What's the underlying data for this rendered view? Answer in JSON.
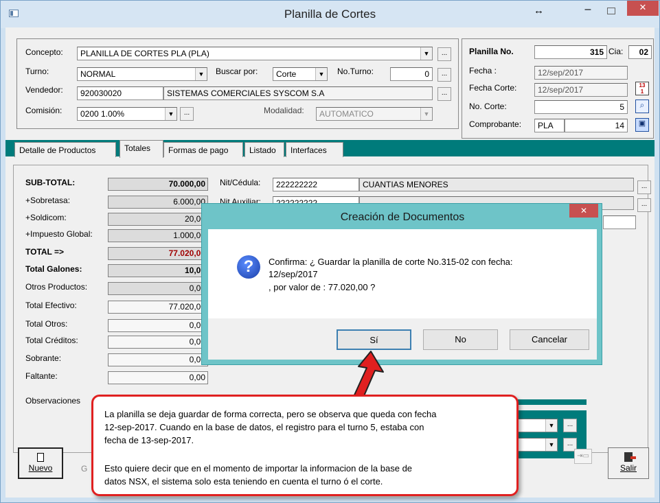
{
  "window": {
    "title": "Planilla de Cortes"
  },
  "header": {
    "concepto_label": "Concepto:",
    "concepto_value": "PLANILLA DE CORTES PLA  (PLA)",
    "turno_label": "Turno:",
    "turno_value": "NORMAL",
    "buscar_label": "Buscar por:",
    "buscar_value": "Corte",
    "noturno_label": "No.Turno:",
    "noturno_value": "0",
    "vendedor_label": "Vendedor:",
    "vendedor_code": "920030020",
    "vendedor_name": "SISTEMAS COMERCIALES SYSCOM S.A",
    "comision_label": "Comisión:",
    "comision_value": "0200  1.00%",
    "modalidad_label": "Modalidad:",
    "modalidad_value": "AUTOMATICO",
    "planilla_label": "Planilla No.",
    "planilla_value": "315",
    "cia_label": "Cia:",
    "cia_value": "02",
    "fecha_label": "Fecha :",
    "fecha_value": "12/sep/2017",
    "fecha_corte_label": "Fecha Corte:",
    "fecha_corte_value": "12/sep/2017",
    "no_corte_label": "No. Corte:",
    "no_corte_value": "5",
    "comprobante_label": "Comprobante:",
    "comprobante_code": "PLA",
    "comprobante_value": "14",
    "ellipsis": "..."
  },
  "tabs": [
    "Detalle de Productos",
    "Totales",
    "Formas de pago",
    "Listado",
    "Interfaces"
  ],
  "totales": {
    "rows": [
      {
        "label": "SUB-TOTAL:",
        "value": "70.000,00"
      },
      {
        "label": "+Sobretasa:",
        "value": "6.000,00"
      },
      {
        "label": "+Soldicom:",
        "value": "20,00"
      },
      {
        "label": "+Impuesto Global:",
        "value": "1.000,00"
      },
      {
        "label": "TOTAL =>",
        "value": "77.020,00"
      },
      {
        "label": "Total Galones:",
        "value": "10,00"
      },
      {
        "label": "Otros Productos:",
        "value": "0,00"
      },
      {
        "label": "Total Efectivo:",
        "value": "77.020,00"
      },
      {
        "label": "Total Otros:",
        "value": "0,00"
      },
      {
        "label": "Total Créditos:",
        "value": "0,00"
      },
      {
        "label": "Sobrante:",
        "value": "0,00"
      },
      {
        "label": "Faltante:",
        "value": "0,00"
      }
    ],
    "nit_label": "Nit/Cédula:",
    "nit_value": "222222222",
    "nit_name": "CUANTIAS MENORES",
    "nit_aux_label": "Nit Auxiliar:",
    "nit_aux_value": "222222222",
    "observaciones_label": "Observaciones"
  },
  "dialog": {
    "title": "Creación de Documentos",
    "line1": "Confirma: ¿ Guardar la planilla de corte No.315-02 con fecha:",
    "line2": "12/sep/2017",
    "line3": ", por valor de : 77.020,00 ?",
    "btn_yes": "Sí",
    "btn_no": "No",
    "btn_cancel": "Cancelar"
  },
  "callout": {
    "p1_l1": "La planilla se deja guardar de forma correcta, pero se observa que queda con fecha",
    "p1_l2": "12-sep-2017. Cuando en la base de datos, el registro para el turno 5, estaba con",
    "p1_l3": "fecha de 13-sep-2017.",
    "p2_l1": "Esto quiere decir que en el momento de importar la informacion de la base de",
    "p2_l2": "datos NSX, el sistema solo esta teniendo en cuenta el turno ó el corte."
  },
  "footer": {
    "nuevo": "Nuevo",
    "nuevo_hidden": "G",
    "salir": "Salir"
  },
  "colors": {
    "teal": "#007b7b",
    "callout_border": "#e02020",
    "dialog_frame": "#6ec4c8",
    "total_red": "#a00000"
  }
}
